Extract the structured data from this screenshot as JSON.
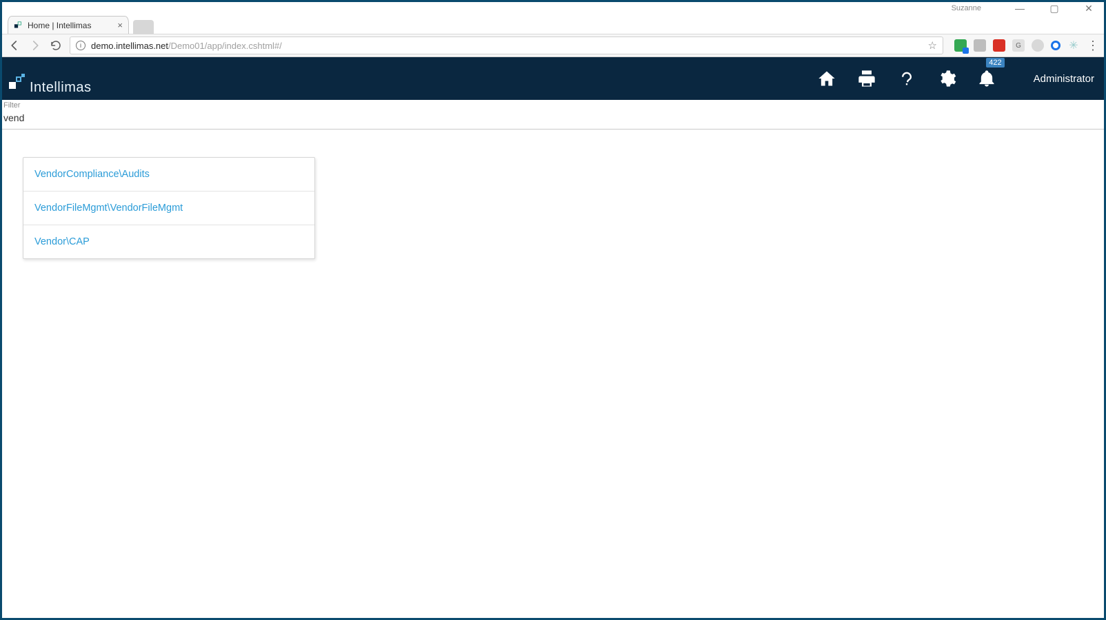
{
  "window": {
    "profile": "Suzanne"
  },
  "tab": {
    "title": "Home | Intellimas"
  },
  "url": {
    "host": "demo.intellimas.net",
    "rest": "/Demo01/app/index.cshtml#/"
  },
  "app": {
    "name": "Intellimas",
    "user": "Administrator",
    "notification_count": "422"
  },
  "filter": {
    "label": "Filter",
    "value": "vend"
  },
  "results": [
    "VendorCompliance\\Audits",
    "VendorFileMgmt\\VendorFileMgmt",
    "Vendor\\CAP"
  ]
}
